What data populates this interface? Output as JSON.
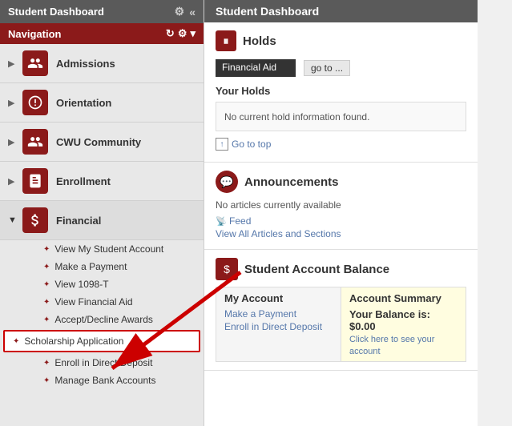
{
  "sidebar": {
    "title": "Student Dashboard",
    "navigation_label": "Navigation",
    "nav_items": [
      {
        "id": "admissions",
        "label": "Admissions",
        "icon": "admissions",
        "expanded": false
      },
      {
        "id": "orientation",
        "label": "Orientation",
        "icon": "orientation",
        "expanded": false
      },
      {
        "id": "cwu-community",
        "label": "CWU Community",
        "icon": "community",
        "expanded": false
      },
      {
        "id": "enrollment",
        "label": "Enrollment",
        "icon": "enrollment",
        "expanded": false
      },
      {
        "id": "financial",
        "label": "Financial",
        "icon": "financial",
        "expanded": true
      }
    ],
    "financial_subitems": [
      {
        "id": "view-student-account",
        "label": "View My Student Account",
        "highlighted": false
      },
      {
        "id": "make-payment",
        "label": "Make a Payment",
        "highlighted": false
      },
      {
        "id": "view-1098t",
        "label": "View 1098-T",
        "highlighted": false
      },
      {
        "id": "view-financial-aid",
        "label": "View Financial Aid",
        "highlighted": false
      },
      {
        "id": "accept-decline",
        "label": "Accept/Decline Awards",
        "highlighted": false
      },
      {
        "id": "scholarship-application",
        "label": "Scholarship Application",
        "highlighted": true
      },
      {
        "id": "enroll-direct-deposit",
        "label": "Enroll in Direct Deposit",
        "highlighted": false
      },
      {
        "id": "manage-bank",
        "label": "Manage Bank Accounts",
        "highlighted": false
      }
    ]
  },
  "main": {
    "title": "Student Dashboard",
    "holds": {
      "title": "Holds",
      "dropdown_value": "Financial Aid",
      "go_to_label": "go to ...",
      "your_holds_label": "Your Holds",
      "no_holds_text": "No current hold information found.",
      "go_to_top_label": "Go to top"
    },
    "announcements": {
      "title": "Announcements",
      "no_articles_text": "No articles currently available",
      "rss_label": "Feed",
      "view_all_label": "View All Articles and Sections"
    },
    "account_balance": {
      "title": "Student Account Balance",
      "my_account_header": "My Account",
      "make_payment_link": "Make a Payment",
      "enroll_direct_link": "Enroll in Direct Deposit",
      "account_summary_header": "Account Summary",
      "balance_label": "Your Balance is: $0.00",
      "click_here_label": "Click here to see your account"
    }
  }
}
